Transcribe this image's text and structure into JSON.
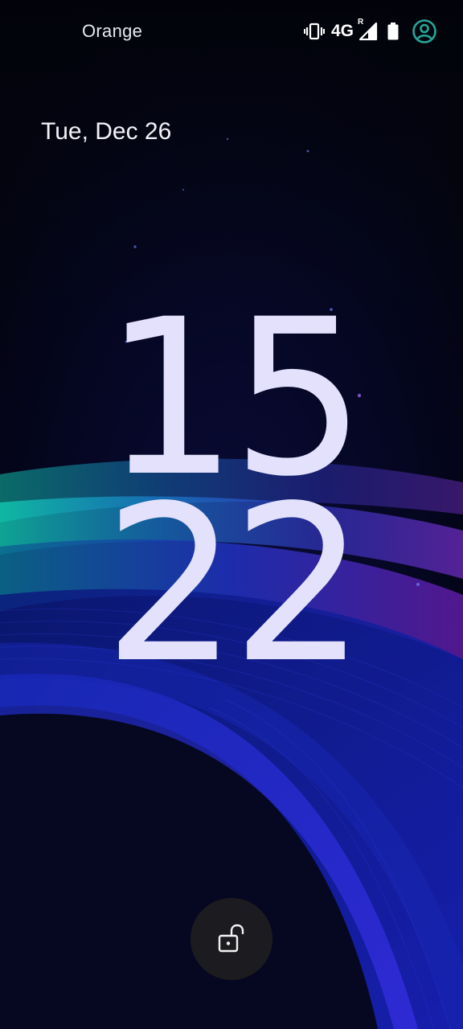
{
  "status_bar": {
    "carrier": "Orange",
    "network_type": "4G",
    "roaming_indicator": "R",
    "icons": [
      "vibrate-icon",
      "signal-icon",
      "battery-icon",
      "user-icon"
    ],
    "user_icon_color": "#26a69a"
  },
  "lockscreen": {
    "date": "Tue, Dec 26",
    "clock_hours": "15",
    "clock_minutes": "22",
    "clock_color": "#e3e1fb",
    "unlock_icon": "lock-open-icon"
  }
}
